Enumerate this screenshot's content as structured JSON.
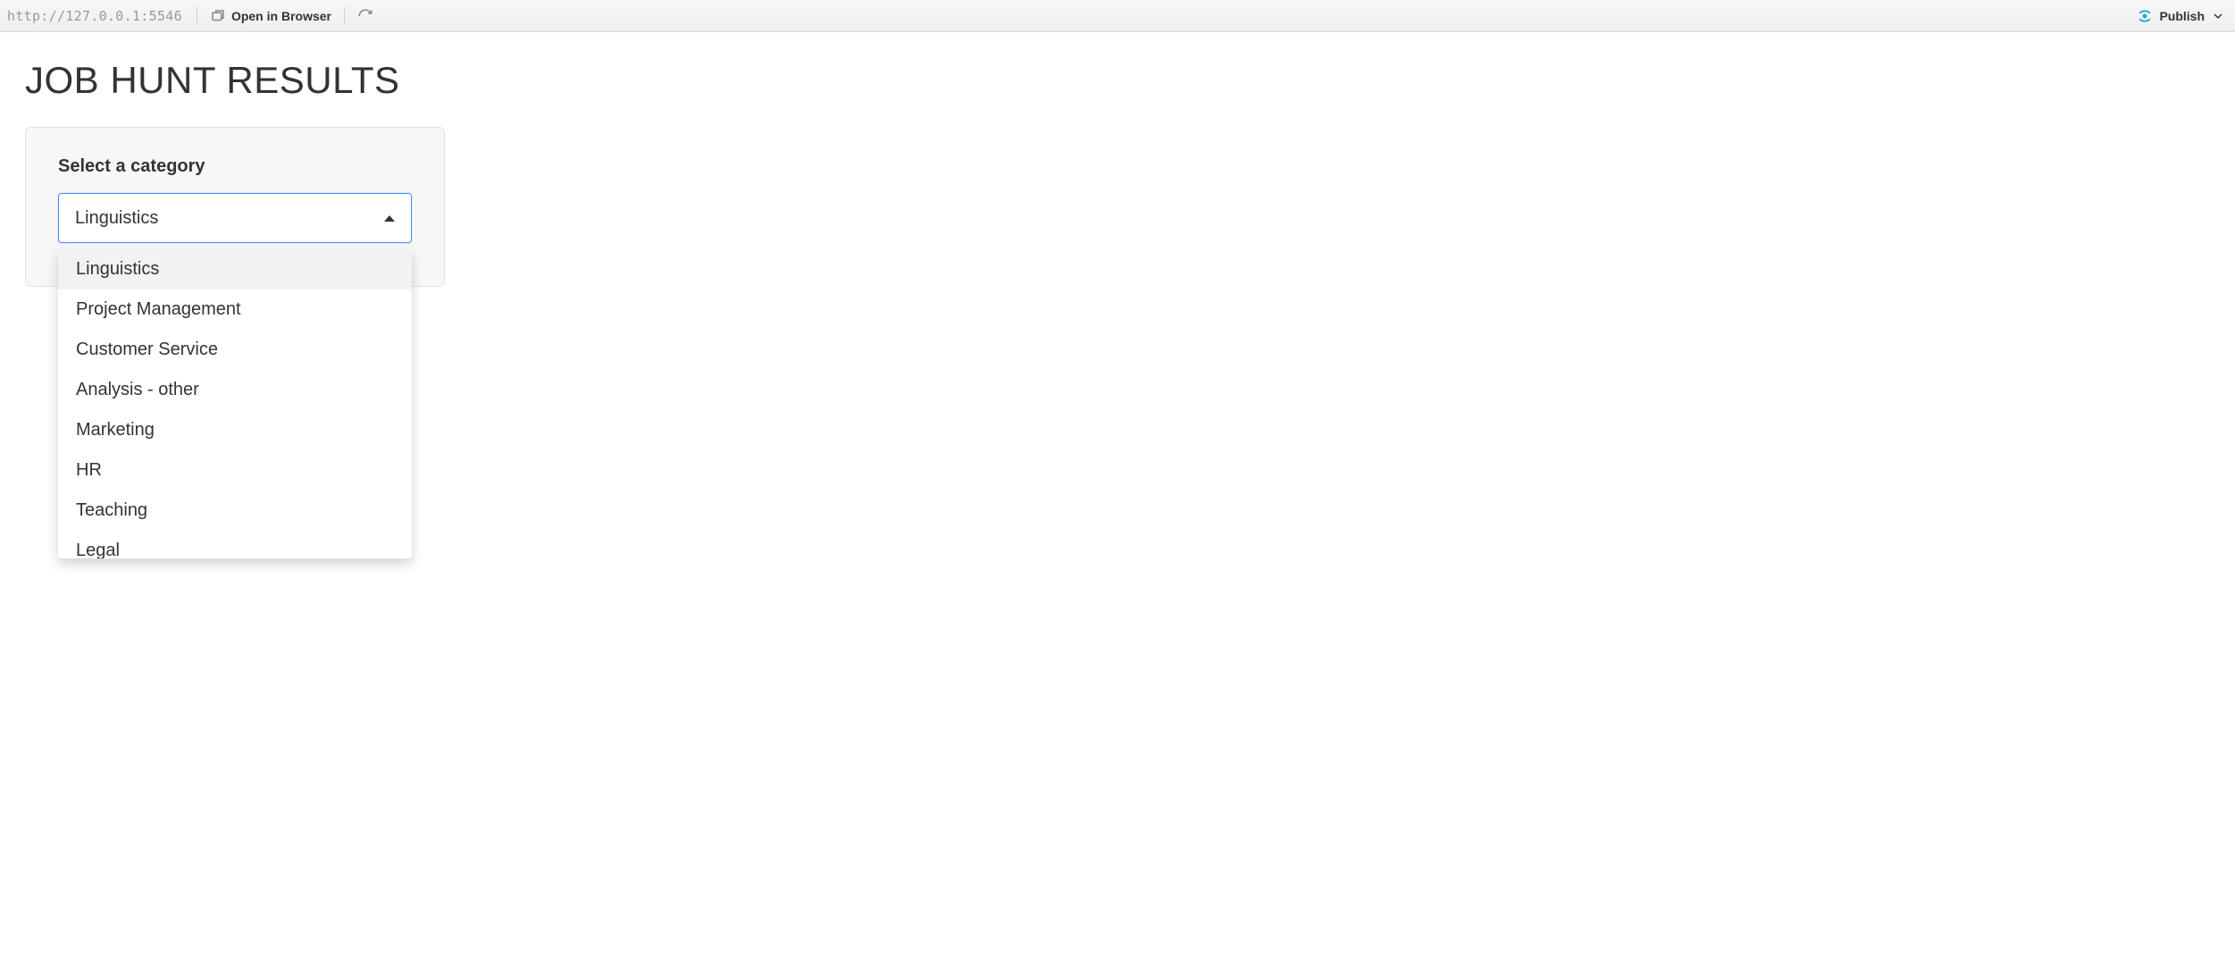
{
  "toolbar": {
    "url": "http://127.0.0.1:5546",
    "open_label": "Open in Browser",
    "publish_label": "Publish"
  },
  "page": {
    "title": "JOB HUNT RESULTS"
  },
  "select": {
    "label": "Select a category",
    "value": "Linguistics",
    "options": [
      "Linguistics",
      "Project Management",
      "Customer Service",
      "Analysis - other",
      "Marketing",
      "HR",
      "Teaching",
      "Legal"
    ]
  }
}
